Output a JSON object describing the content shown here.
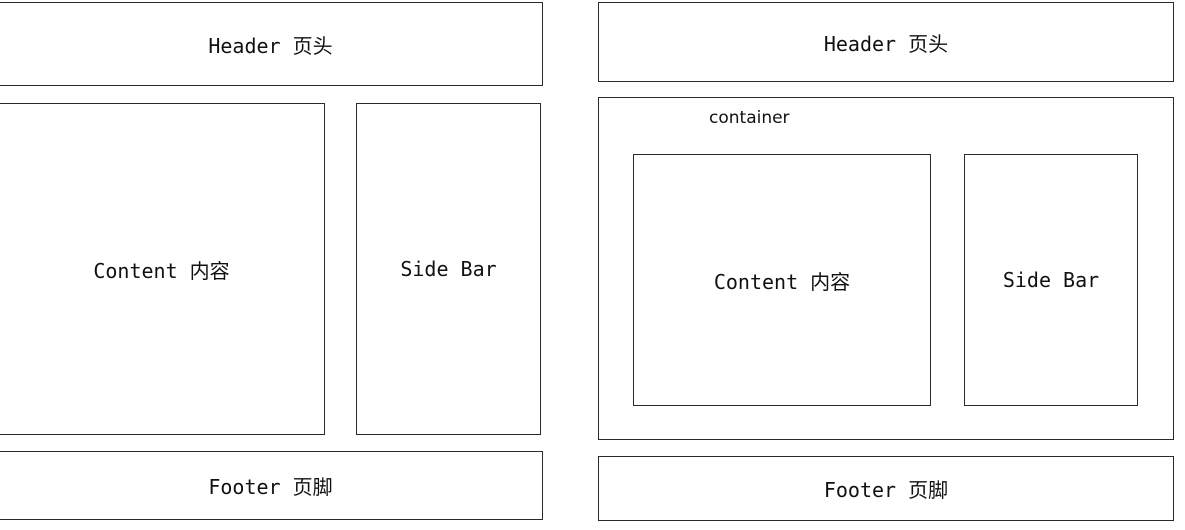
{
  "left_layout": {
    "header": "Header 页头",
    "content": "Content 内容",
    "sidebar": "Side Bar",
    "footer": "Footer 页脚"
  },
  "right_layout": {
    "header": "Header 页头",
    "container": "container",
    "content": "Content 内容",
    "sidebar": "Side Bar",
    "footer": "Footer 页脚"
  }
}
